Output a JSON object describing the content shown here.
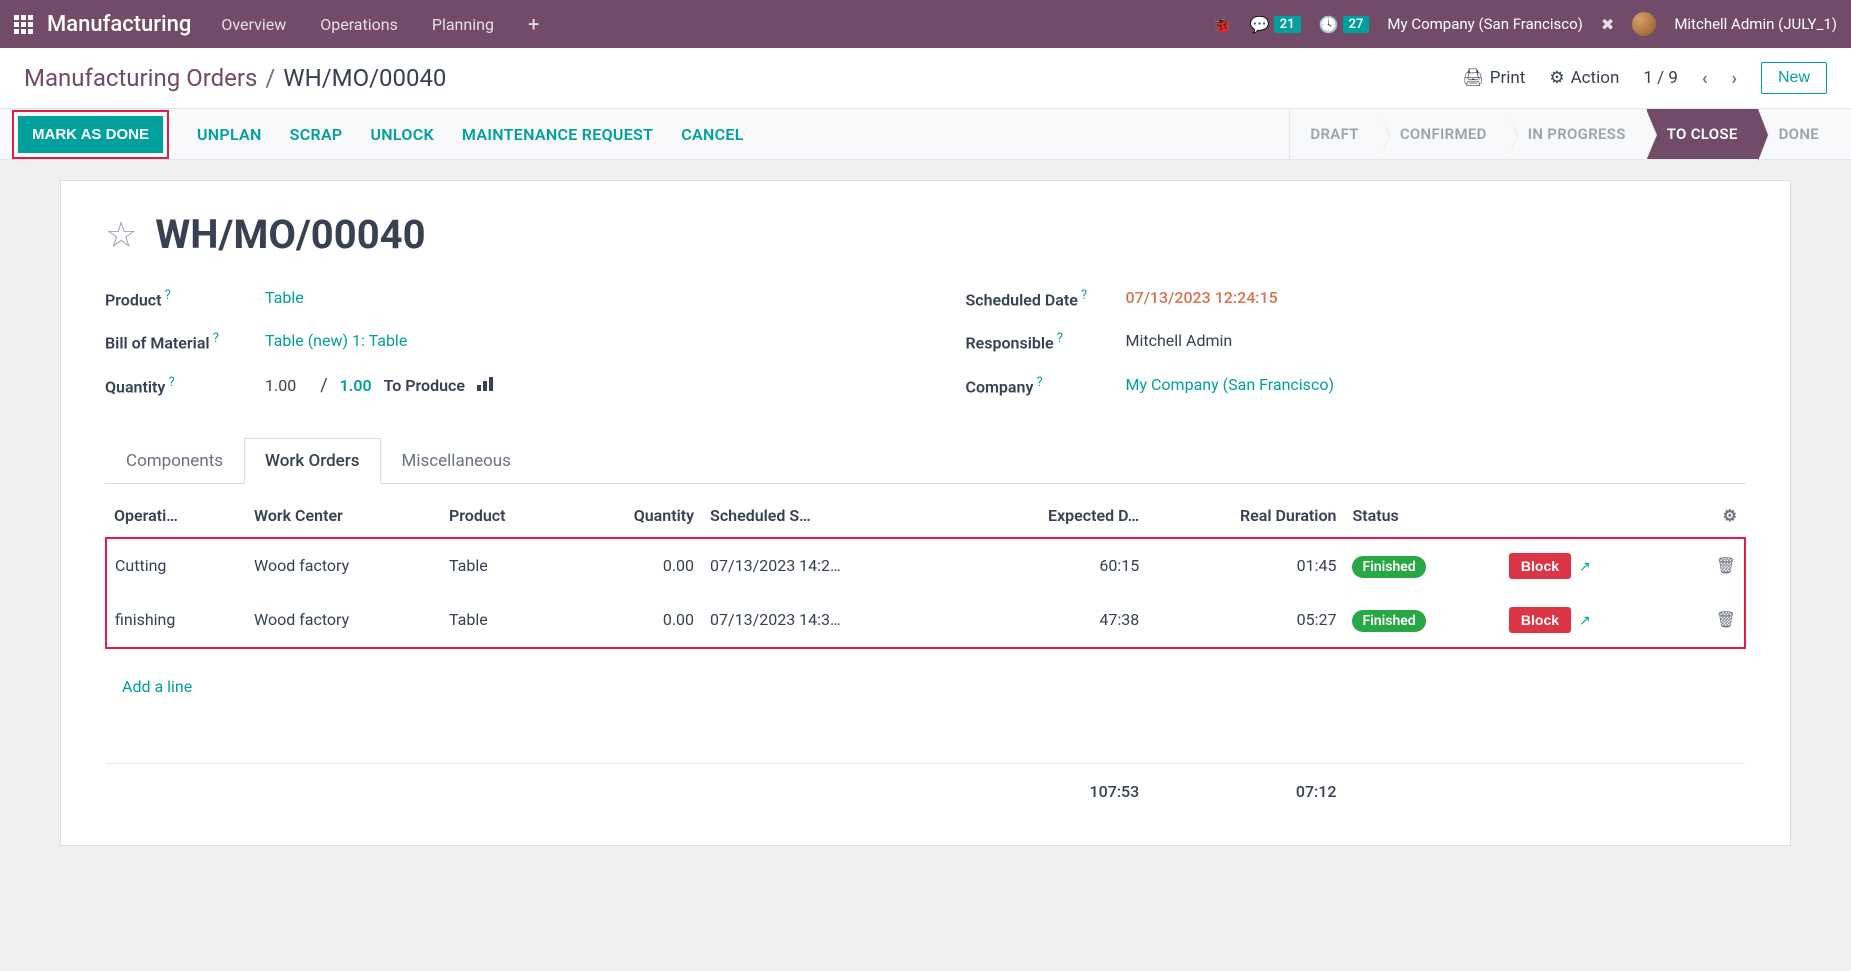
{
  "header": {
    "app_name": "Manufacturing",
    "menu": [
      "Overview",
      "Operations",
      "Planning"
    ],
    "msg_badge": "21",
    "activity_badge": "27",
    "company": "My Company (San Francisco)",
    "user": "Mitchell Admin (JULY_1)"
  },
  "breadcrumb": {
    "parent": "Manufacturing Orders",
    "current": "WH/MO/00040",
    "print": "Print",
    "action": "Action",
    "pager": "1 / 9",
    "new": "New"
  },
  "actions": {
    "mark_done": "MARK AS DONE",
    "unplan": "UNPLAN",
    "scrap": "SCRAP",
    "unlock": "UNLOCK",
    "maintenance": "MAINTENANCE REQUEST",
    "cancel": "CANCEL"
  },
  "status_steps": [
    "DRAFT",
    "CONFIRMED",
    "IN PROGRESS",
    "TO CLOSE",
    "DONE"
  ],
  "order": {
    "name": "WH/MO/00040",
    "labels": {
      "product": "Product",
      "bom": "Bill of Material",
      "quantity": "Quantity",
      "scheduled": "Scheduled Date",
      "responsible": "Responsible",
      "company": "Company",
      "to_produce": "To Produce"
    },
    "product": "Table",
    "bom": "Table (new) 1: Table",
    "qty": "1.00",
    "qty_target": "1.00",
    "scheduled": "07/13/2023 12:24:15",
    "responsible": "Mitchell Admin",
    "company": "My Company (San Francisco)"
  },
  "tabs": {
    "components": "Components",
    "work_orders": "Work Orders",
    "misc": "Miscellaneous"
  },
  "wo_headers": {
    "operation": "Operati…",
    "work_center": "Work Center",
    "product": "Product",
    "quantity": "Quantity",
    "scheduled": "Scheduled S…",
    "expected": "Expected D…",
    "real": "Real Duration",
    "status": "Status"
  },
  "work_orders": [
    {
      "operation": "Cutting",
      "work_center": "Wood factory",
      "product": "Table",
      "qty": "0.00",
      "scheduled": "07/13/2023 14:2…",
      "expected": "60:15",
      "real": "01:45",
      "status": "Finished",
      "block": "Block"
    },
    {
      "operation": "finishing",
      "work_center": "Wood factory",
      "product": "Table",
      "qty": "0.00",
      "scheduled": "07/13/2023 14:3…",
      "expected": "47:38",
      "real": "05:27",
      "status": "Finished",
      "block": "Block"
    }
  ],
  "add_line": "Add a line",
  "totals": {
    "expected": "107:53",
    "real": "07:12"
  }
}
